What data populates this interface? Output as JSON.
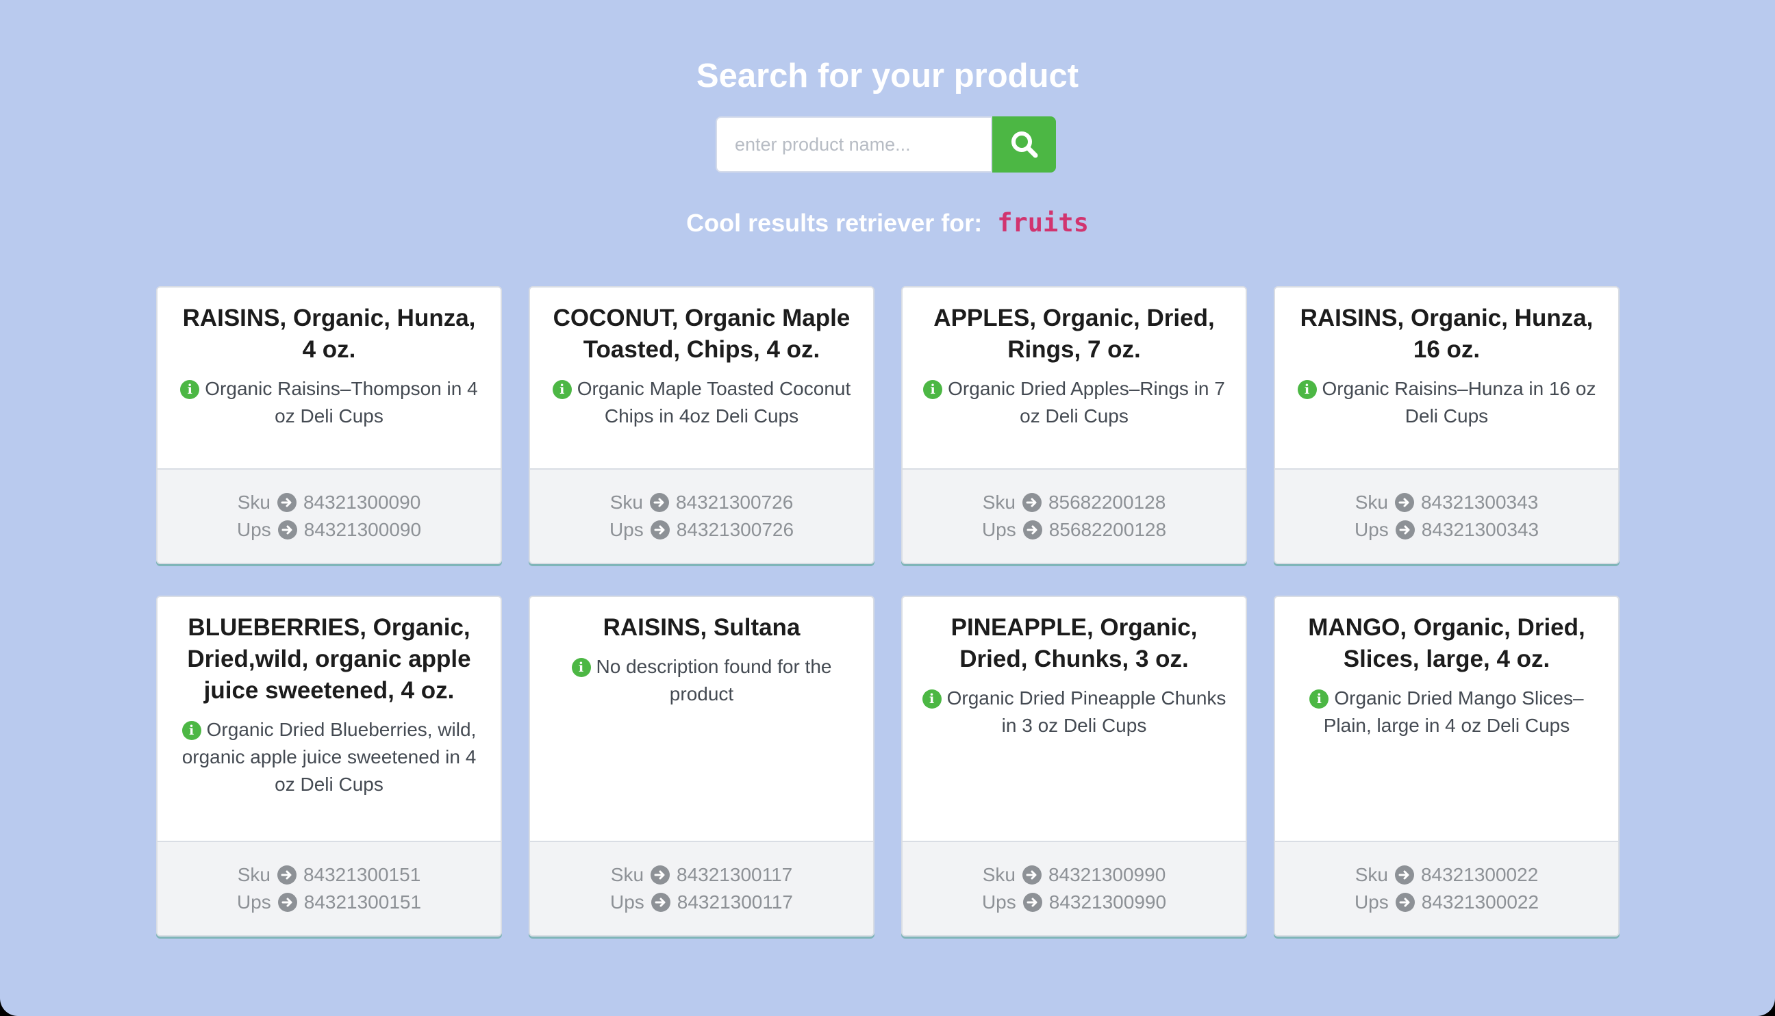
{
  "header": {
    "title": "Search for your product"
  },
  "search": {
    "placeholder": "enter product name...",
    "value": ""
  },
  "results": {
    "label": "Cool results retriever for:",
    "query": "fruits"
  },
  "card_labels": {
    "sku": "Sku",
    "ups": "Ups"
  },
  "colors": {
    "background": "#b9caee",
    "accent": "#4cb744",
    "query_text": "#d1346f"
  },
  "products": [
    {
      "title": "RAISINS, Organic, Hunza, 4 oz.",
      "description": "Organic Raisins–Thompson in 4 oz Deli Cups",
      "sku": "84321300090",
      "ups": "84321300090"
    },
    {
      "title": "COCONUT, Organic Maple Toasted, Chips, 4 oz.",
      "description": "Organic Maple Toasted Coconut Chips in 4oz Deli Cups",
      "sku": "84321300726",
      "ups": "84321300726"
    },
    {
      "title": "APPLES, Organic, Dried, Rings, 7 oz.",
      "description": "Organic Dried Apples–Rings in 7 oz Deli Cups",
      "sku": "85682200128",
      "ups": "85682200128"
    },
    {
      "title": "RAISINS, Organic, Hunza, 16 oz.",
      "description": "Organic Raisins–Hunza in 16 oz Deli Cups",
      "sku": "84321300343",
      "ups": "84321300343"
    },
    {
      "title": "BLUEBERRIES, Organic, Dried,wild, organic apple juice sweetened, 4 oz.",
      "description": "Organic Dried Blueberries, wild, organic apple juice sweetened in 4 oz Deli Cups",
      "sku": "84321300151",
      "ups": "84321300151"
    },
    {
      "title": "RAISINS, Sultana",
      "description": "No description found for the product",
      "sku": "84321300117",
      "ups": "84321300117"
    },
    {
      "title": "PINEAPPLE, Organic, Dried, Chunks, 3 oz.",
      "description": "Organic Dried Pineapple Chunks in 3 oz Deli Cups",
      "sku": "84321300990",
      "ups": "84321300990"
    },
    {
      "title": "MANGO, Organic, Dried, Slices, large, 4 oz.",
      "description": "Organic Dried Mango Slices–Plain, large in 4 oz Deli Cups",
      "sku": "84321300022",
      "ups": "84321300022"
    }
  ]
}
